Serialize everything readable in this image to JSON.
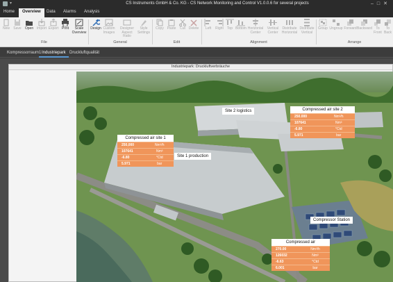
{
  "window": {
    "title": "CS Instruments GmbH & Co. KG - CS Network Monitoring and Control V1.0.0.6 for several projects",
    "quick_access": "▾"
  },
  "tabs": [
    {
      "label": "Home"
    },
    {
      "label": "Overview"
    },
    {
      "label": "Data"
    },
    {
      "label": "Alarms"
    },
    {
      "label": "Analysis"
    }
  ],
  "ribbon": {
    "buttons": [
      {
        "label": "New",
        "icon": "new-document-icon",
        "enabled": false
      },
      {
        "label": "Save",
        "icon": "save-icon",
        "enabled": false
      },
      {
        "label": "Open",
        "icon": "open-folder-icon",
        "enabled": true
      },
      {
        "label": "Import",
        "icon": "import-icon",
        "enabled": false
      },
      {
        "label": "Export",
        "icon": "export-icon",
        "enabled": false
      },
      {
        "label": "Print",
        "icon": "print-icon",
        "enabled": true
      },
      {
        "label": "Scale Overview",
        "icon": "scale-icon",
        "enabled": true
      },
      {
        "label": "Design",
        "icon": "wrench-icon",
        "enabled": true
      },
      {
        "label": "Custom Images",
        "icon": "image-icon",
        "enabled": false
      },
      {
        "label": "Designer Aspect Ratio",
        "icon": "aspect-ratio-icon",
        "enabled": false
      },
      {
        "label": "Style Settings",
        "icon": "style-icon",
        "enabled": false
      },
      {
        "label": "Copy",
        "icon": "copy-icon",
        "enabled": false
      },
      {
        "label": "Paste",
        "icon": "paste-icon",
        "enabled": false
      },
      {
        "label": "Cut",
        "icon": "cut-icon",
        "enabled": false
      },
      {
        "label": "Delete",
        "icon": "delete-icon",
        "enabled": false
      },
      {
        "label": "Left",
        "icon": "align-left-icon",
        "enabled": false
      },
      {
        "label": "Right",
        "icon": "align-right-icon",
        "enabled": false
      },
      {
        "label": "Top",
        "icon": "align-top-icon",
        "enabled": false
      },
      {
        "label": "Bottom",
        "icon": "align-bottom-icon",
        "enabled": false
      },
      {
        "label": "Horizontal Center",
        "icon": "align-hcenter-icon",
        "enabled": false
      },
      {
        "label": "Vertical Center",
        "icon": "align-vcenter-icon",
        "enabled": false
      },
      {
        "label": "Distribute Horizontal",
        "icon": "distribute-h-icon",
        "enabled": false
      },
      {
        "label": "Distribute Vertical",
        "icon": "distribute-v-icon",
        "enabled": false
      },
      {
        "label": "Group",
        "icon": "group-icon",
        "enabled": false
      },
      {
        "label": "Ungroup",
        "icon": "ungroup-icon",
        "enabled": false
      },
      {
        "label": "Forward",
        "icon": "forward-icon",
        "enabled": false
      },
      {
        "label": "Backward",
        "icon": "backward-icon",
        "enabled": false
      },
      {
        "label": "To Front",
        "icon": "to-front-icon",
        "enabled": false
      },
      {
        "label": "To Back",
        "icon": "to-back-icon",
        "enabled": false
      }
    ],
    "groups": [
      {
        "label": "File"
      },
      {
        "label": "General"
      },
      {
        "label": "Edit"
      },
      {
        "label": "Alignment"
      },
      {
        "label": "Arrange"
      }
    ]
  },
  "doc_tabs": [
    {
      "label": "Kompressorraum1"
    },
    {
      "label": "Industriepark"
    },
    {
      "label": "Druckluftqualität"
    }
  ],
  "page": {
    "header": "Industriepark: Druckluftverbräuche"
  },
  "labels": {
    "site2_logistics": "Site 2 logistics",
    "site1_production": "Site 1 production",
    "compressor_station": "Compressor Station"
  },
  "cards": [
    {
      "title": "Compressed air site 1",
      "rows": [
        {
          "value": "250,000",
          "unit": "Nm³/h"
        },
        {
          "value": "107641",
          "unit": "Nm³"
        },
        {
          "value": "-6.80",
          "unit": "°Ctd"
        },
        {
          "value": "5.971",
          "unit": "bar"
        }
      ]
    },
    {
      "title": "Compressed air site 2",
      "rows": [
        {
          "value": "250.000",
          "unit": "Nm³/h"
        },
        {
          "value": "107641",
          "unit": "Nm³"
        },
        {
          "value": "-6.80",
          "unit": "°Ctd"
        },
        {
          "value": "5.971",
          "unit": "bar"
        }
      ]
    },
    {
      "title": "Compressed air",
      "rows": [
        {
          "value": "270.00",
          "unit": "Nm³/h"
        },
        {
          "value": "126032",
          "unit": "Nm³"
        },
        {
          "value": "-6.63",
          "unit": "°Ctd"
        },
        {
          "value": "6.001",
          "unit": "bar"
        }
      ]
    }
  ],
  "colors": {
    "accent_orange": "#f0955a",
    "tab_bar": "#2b2b2b",
    "ribbon_bg": "#f0f0f0"
  }
}
